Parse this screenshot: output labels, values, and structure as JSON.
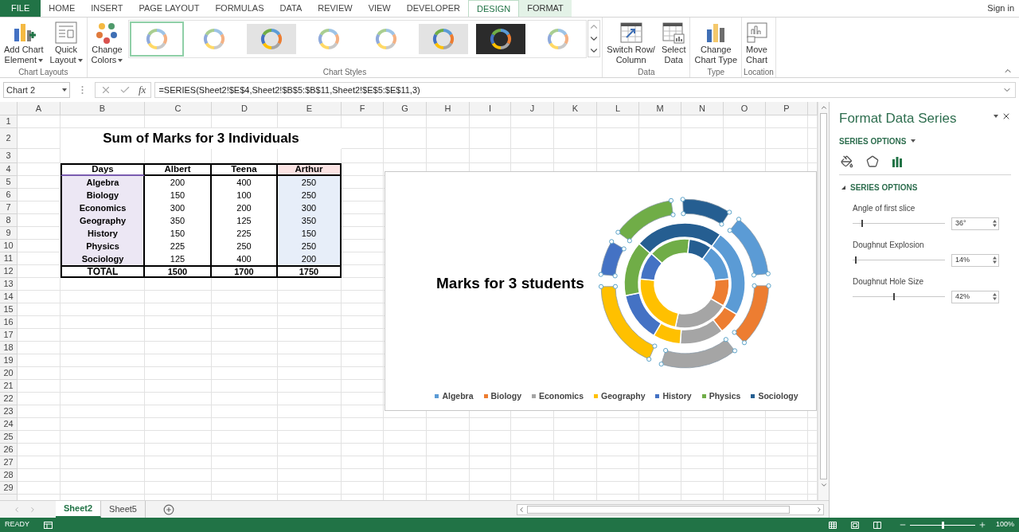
{
  "ribbon_tabs": [
    {
      "label": "FILE",
      "kind": "file",
      "selected": false
    },
    {
      "label": "HOME",
      "kind": "tab",
      "selected": false
    },
    {
      "label": "INSERT",
      "kind": "tab",
      "selected": false
    },
    {
      "label": "PAGE LAYOUT",
      "kind": "tab",
      "selected": false
    },
    {
      "label": "FORMULAS",
      "kind": "tab",
      "selected": false
    },
    {
      "label": "DATA",
      "kind": "tab",
      "selected": false
    },
    {
      "label": "REVIEW",
      "kind": "tab",
      "selected": false
    },
    {
      "label": "VIEW",
      "kind": "tab",
      "selected": false
    },
    {
      "label": "DEVELOPER",
      "kind": "tab",
      "selected": false
    },
    {
      "label": "DESIGN",
      "kind": "contextual",
      "selected": true
    },
    {
      "label": "FORMAT",
      "kind": "contextual",
      "selected": false
    }
  ],
  "sign_in": "Sign in",
  "ribbon_groups": [
    {
      "label": "Chart Layouts",
      "items": [
        {
          "kind": "add",
          "lines": [
            "Add Chart",
            "Element"
          ],
          "dropdown": true
        },
        {
          "kind": "layout",
          "lines": [
            "Quick",
            "Layout"
          ],
          "dropdown": true
        }
      ]
    },
    {
      "label": "Chart Styles",
      "items": [
        {
          "kind": "colors",
          "lines": [
            "Change",
            "Colors"
          ],
          "dropdown": true
        },
        {
          "kind": "gallery",
          "styles": [
            {
              "kind": "white",
              "selected": true
            },
            {
              "kind": "white",
              "selected": false
            },
            {
              "kind": "gray",
              "selected": false
            },
            {
              "kind": "white",
              "selected": false
            },
            {
              "kind": "white",
              "selected": false
            },
            {
              "kind": "gray",
              "selected": false
            },
            {
              "kind": "dark",
              "selected": false
            },
            {
              "kind": "white",
              "selected": false
            }
          ]
        }
      ]
    },
    {
      "label": "Data",
      "items": [
        {
          "kind": "switch",
          "lines": [
            "Switch Row/",
            "Column"
          ],
          "dropdown": false
        },
        {
          "kind": "select",
          "lines": [
            "Select",
            "Data"
          ],
          "dropdown": false
        }
      ]
    },
    {
      "label": "Type",
      "items": [
        {
          "kind": "type",
          "lines": [
            "Change",
            "Chart Type"
          ],
          "dropdown": false
        }
      ]
    },
    {
      "label": "Location",
      "items": [
        {
          "kind": "move",
          "lines": [
            "Move",
            "Chart"
          ],
          "dropdown": false
        }
      ]
    }
  ],
  "formula_bar": {
    "name_box": "Chart 2",
    "function_label": "fx",
    "formula": "=SERIES(Sheet2!$E$4,Sheet2!$B$5:$B$11,Sheet2!$E$5:$E$11,3)"
  },
  "columns": [
    "A",
    "B",
    "C",
    "D",
    "E",
    "F",
    "G",
    "H",
    "I",
    "J",
    "K",
    "L",
    "M",
    "N",
    "O",
    "P"
  ],
  "rows": [
    "1",
    "2",
    "3",
    "4",
    "5",
    "6",
    "7",
    "8",
    "9",
    "10",
    "11",
    "12",
    "13",
    "14",
    "15",
    "16",
    "17",
    "18",
    "19",
    "20",
    "21",
    "22",
    "23",
    "24",
    "25",
    "26",
    "27",
    "28",
    "29"
  ],
  "sheet": {
    "title": "Sum of Marks for 3 Individuals",
    "table": {
      "columns": [
        {
          "label": "Days",
          "category_range": true,
          "series_range": false
        },
        {
          "label": "Albert",
          "category_range": false,
          "series_range": false
        },
        {
          "label": "Teena",
          "category_range": false,
          "series_range": false
        },
        {
          "label": "Arthur",
          "category_range": false,
          "series_range": true
        }
      ],
      "rows": [
        {
          "cells": [
            "Algebra",
            "200",
            "400",
            "250"
          ]
        },
        {
          "cells": [
            "Biology",
            "150",
            "100",
            "250"
          ]
        },
        {
          "cells": [
            "Economics",
            "300",
            "200",
            "300"
          ]
        },
        {
          "cells": [
            "Geography",
            "350",
            "125",
            "350"
          ]
        },
        {
          "cells": [
            "History",
            "150",
            "225",
            "150"
          ]
        },
        {
          "cells": [
            "Physics",
            "225",
            "250",
            "250"
          ]
        },
        {
          "cells": [
            "Sociology",
            "125",
            "400",
            "200"
          ]
        }
      ],
      "total": [
        "TOTAL",
        "1500",
        "1700",
        "1750"
      ]
    }
  },
  "chart": {
    "title": "Marks for 3 students",
    "legend": [
      {
        "label": "Algebra",
        "color": "#5b9bd5"
      },
      {
        "label": "Biology",
        "color": "#ed7d31"
      },
      {
        "label": "Economics",
        "color": "#a5a5a5"
      },
      {
        "label": "Geography",
        "color": "#ffc000"
      },
      {
        "label": "History",
        "color": "#4472c4"
      },
      {
        "label": "Physics",
        "color": "#70ad47"
      },
      {
        "label": "Sociology",
        "color": "#255e91"
      }
    ]
  },
  "panel": {
    "title": "Format Data Series",
    "dropdown": "SERIES OPTIONS",
    "icons": [
      {
        "kind": "fill",
        "selected": false
      },
      {
        "kind": "effects",
        "selected": false
      },
      {
        "kind": "options",
        "selected": true
      }
    ],
    "section": "SERIES OPTIONS",
    "settings": [
      {
        "label": "Angle of first slice",
        "level": 0.1,
        "value": "36°"
      },
      {
        "label": "Doughnut Explosion",
        "level": 0.03,
        "value": "14%"
      },
      {
        "label": "Doughnut Hole Size",
        "level": 0.45,
        "value": "42%"
      }
    ]
  },
  "sheet_tabs": [
    {
      "label": "Sheet2",
      "selected": true
    },
    {
      "label": "Sheet5",
      "selected": false
    }
  ],
  "status_bar": {
    "status": "READY",
    "zoom": "100%",
    "zoom_level": {
      "level": 0.5
    }
  }
}
